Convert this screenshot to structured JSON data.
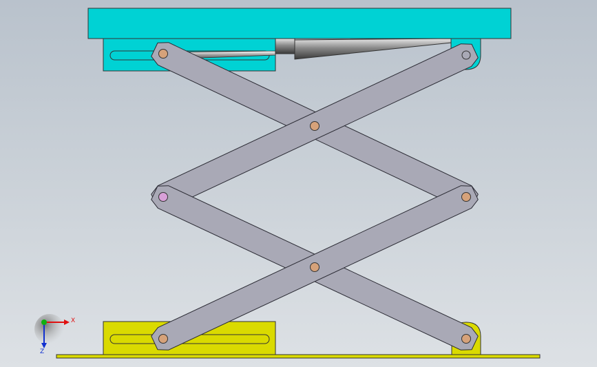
{
  "viewport": {
    "background": "#c6cdd4"
  },
  "colors": {
    "platform": "#00d2d4",
    "base": "#dada00",
    "floor": "#dada00",
    "arm_fill": "#a9a9b6",
    "arm_stroke": "#2a2a33",
    "pin": "#d6a27a",
    "pin_highlight": "#d8a0d8",
    "axis_x": "#e01010",
    "axis_y": "#10b010",
    "axis_z": "#1030d0"
  },
  "parts": {
    "platform": "top-platform",
    "base": "base-plate",
    "floor": "floor-plate",
    "actuator": "hydraulic-cylinder",
    "arms": [
      "upper-arm-a",
      "upper-arm-b",
      "lower-arm-a",
      "lower-arm-b"
    ],
    "pins": [
      "pin-top-left",
      "pin-top-right",
      "pin-center-upper",
      "pin-mid-left",
      "pin-mid-right",
      "pin-center-lower",
      "pin-bottom-left",
      "pin-bottom-right"
    ]
  },
  "triad": {
    "x_label": "X",
    "z_label": "Z"
  }
}
